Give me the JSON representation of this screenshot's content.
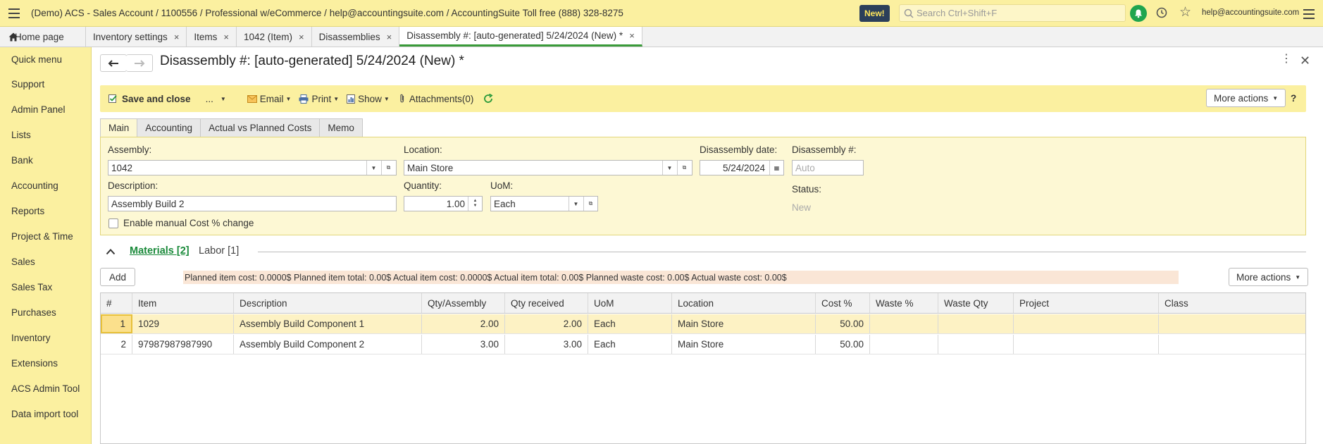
{
  "header": {
    "app_title": "(Demo) ACS - Sales Account / 1100556 / Professional w/eCommerce / help@accountingsuite.com / AccountingSuite Toll free (888) 328-8275",
    "new_badge": "New!",
    "search_placeholder": "Search Ctrl+Shift+F",
    "user_email": "help@accountingsuite.com"
  },
  "tabs": {
    "home": "Home page",
    "open": [
      {
        "label": "Inventory settings",
        "close": "×"
      },
      {
        "label": "Items",
        "close": "×"
      },
      {
        "label": "1042 (Item)",
        "close": "×"
      },
      {
        "label": "Disassemblies",
        "close": "×"
      },
      {
        "label": "Disassembly #: [auto-generated] 5/24/2024 (New) *",
        "close": "×"
      }
    ]
  },
  "sidebar": {
    "items": [
      "Quick menu",
      "Support",
      "Admin Panel",
      "Lists",
      "Bank",
      "Accounting",
      "Reports",
      "Project & Time",
      "Sales",
      "Sales Tax",
      "Purchases",
      "Inventory",
      "Extensions",
      "ACS Admin Tool",
      "Data import tool"
    ]
  },
  "form": {
    "title": "Disassembly #: [auto-generated] 5/24/2024 (New) *",
    "toolbar": {
      "save_close": "Save and close",
      "ellipsis": "...",
      "email": "Email",
      "print": "Print",
      "show": "Show",
      "attachments": "Attachments(0)",
      "more_actions": "More actions",
      "help": "?"
    },
    "tabs": [
      "Main",
      "Accounting",
      "Actual vs Planned Costs",
      "Memo"
    ],
    "fields": {
      "assembly_label": "Assembly:",
      "assembly_value": "1042",
      "location_label": "Location:",
      "location_value": "Main Store",
      "date_label": "Disassembly date:",
      "date_value": "5/24/2024",
      "number_label": "Disassembly #:",
      "number_placeholder": "Auto",
      "description_label": "Description:",
      "description_value": "Assembly Build 2",
      "quantity_label": "Quantity:",
      "quantity_value": "1.00",
      "uom_label": "UoM:",
      "uom_value": "Each",
      "status_label": "Status:",
      "status_value": "New",
      "manual_cost_label": "Enable manual Cost % change"
    },
    "section": {
      "materials": "Materials [2]",
      "labor": "Labor [1]"
    },
    "materials": {
      "add_label": "Add",
      "more_actions": "More actions",
      "totals": "Planned item cost: 0.0000$  Planned item total: 0.00$  Actual item cost: 0.0000$  Actual item total: 0.00$  Planned waste cost: 0.00$  Actual waste cost: 0.00$",
      "columns": [
        "#",
        "Item",
        "Description",
        "Qty/Assembly",
        "Qty received",
        "UoM",
        "Location",
        "Cost %",
        "Waste %",
        "Waste Qty",
        "Project",
        "Class"
      ],
      "rows": [
        [
          "1",
          "1029",
          "Assembly Build Component 1",
          "2.00",
          "2.00",
          "Each",
          "Main Store",
          "50.00",
          "",
          "",
          "",
          ""
        ],
        [
          "2",
          "97987987987990",
          "Assembly Build Component 2",
          "3.00",
          "3.00",
          "Each",
          "Main Store",
          "50.00",
          "",
          "",
          "",
          ""
        ]
      ]
    }
  },
  "colors": {
    "accent_yellow": "#fbf0a0",
    "panel_yellow": "#fdf8d4",
    "active_green": "#1fa54f",
    "link_green": "#1a8a3a"
  }
}
